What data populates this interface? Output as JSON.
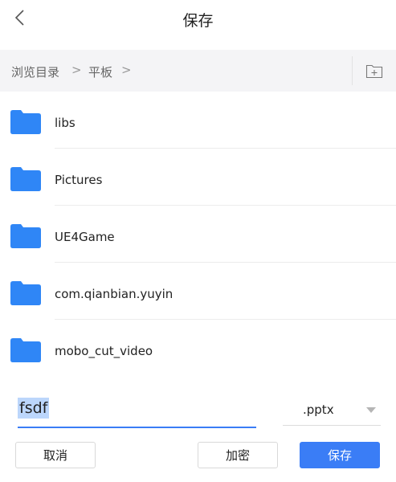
{
  "header": {
    "title": "保存",
    "back_icon": "chevron-left-icon"
  },
  "breadcrumb": {
    "items": [
      "浏览目录",
      "平板"
    ],
    "separator": ">",
    "new_folder_icon": "new-folder-icon"
  },
  "folders": [
    {
      "name": "libs"
    },
    {
      "name": "Pictures"
    },
    {
      "name": "UE4Game"
    },
    {
      "name": "com.qianbian.yuyin"
    },
    {
      "name": "mobo_cut_video"
    }
  ],
  "save_form": {
    "file_name": "fsdf",
    "extension": ".pptx",
    "cancel_label": "取消",
    "encrypt_label": "加密",
    "save_label": "保存"
  },
  "colors": {
    "accent": "#3a7df6",
    "folder": "#2f86f6",
    "breadcrumb_bg": "#f4f4f6"
  }
}
